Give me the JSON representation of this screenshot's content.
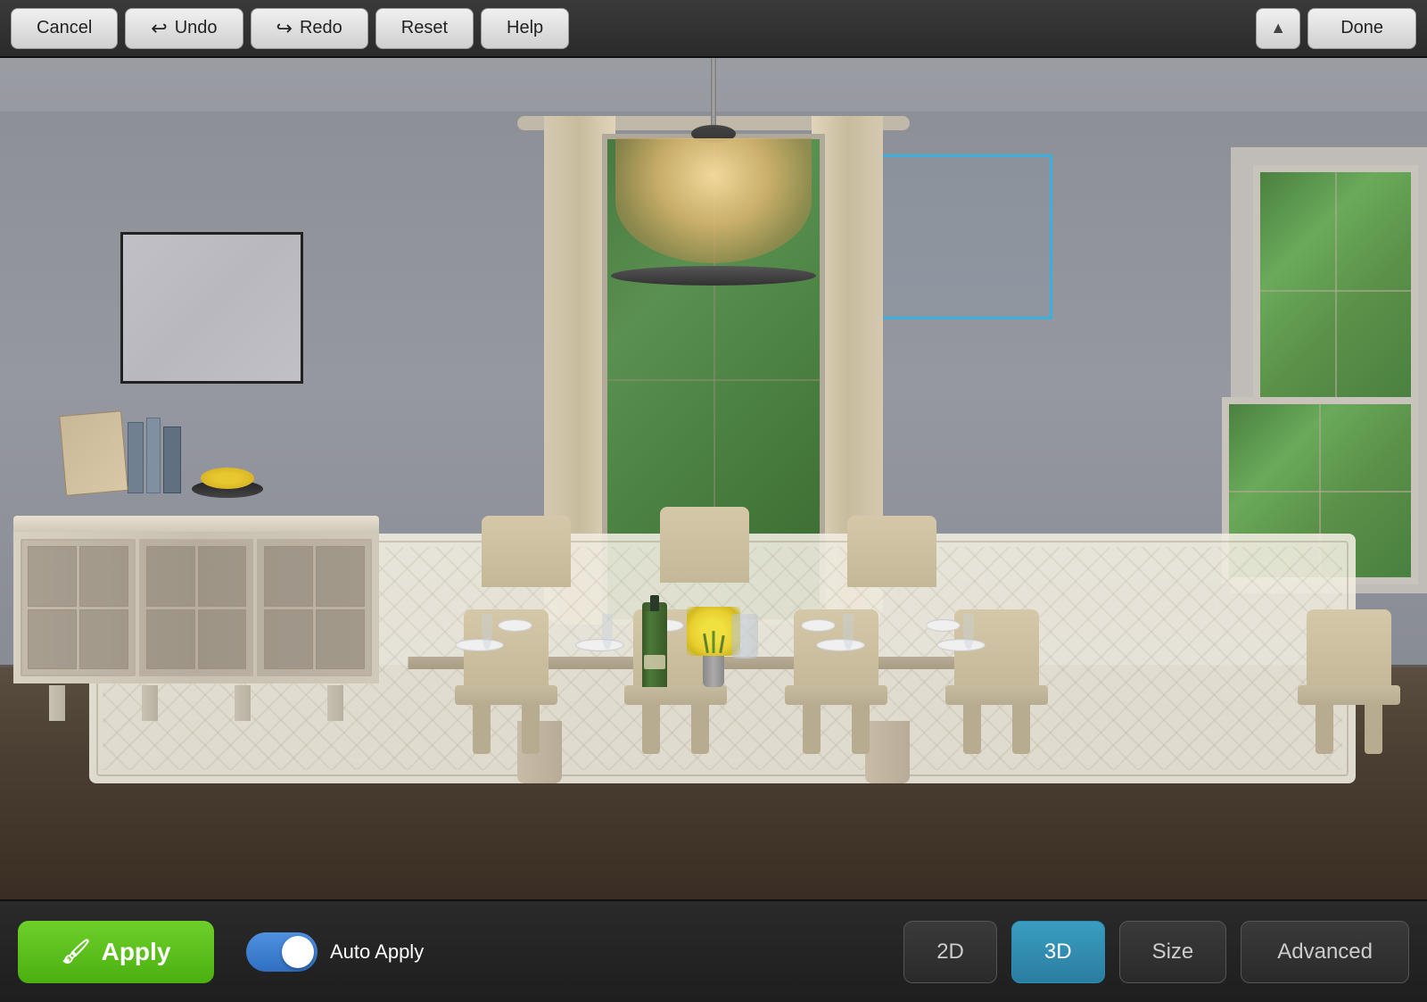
{
  "toolbar": {
    "cancel_label": "Cancel",
    "undo_label": "Undo",
    "redo_label": "Redo",
    "reset_label": "Reset",
    "help_label": "Help",
    "done_label": "Done",
    "chevron_up": "▲"
  },
  "bottom_bar": {
    "apply_label": "Apply",
    "auto_apply_label": "Auto Apply",
    "btn_2d_label": "2D",
    "btn_3d_label": "3D",
    "size_label": "Size",
    "advanced_label": "Advanced",
    "toggle_state": "on"
  },
  "scene": {
    "description": "Dining room interior with table, chairs, chandelier, and sideboard"
  },
  "icons": {
    "undo_arrow": "↩",
    "redo_arrow": "↪",
    "apply_paint": "🖌"
  }
}
